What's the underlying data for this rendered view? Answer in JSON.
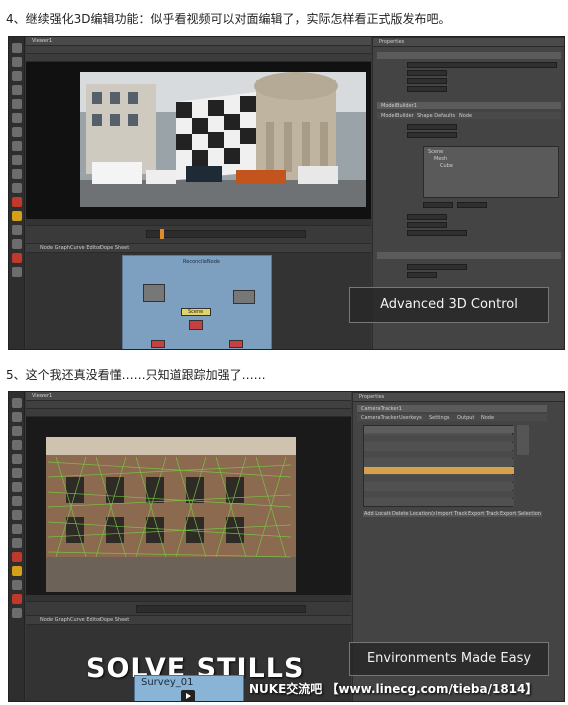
{
  "captions": {
    "first": "4、继续强化3D编辑功能：似乎看视频可以对面编辑了，实际怎样看正式版发布吧。",
    "second": "5、这个我还真没看懂……只知道跟踪加强了……"
  },
  "shot1": {
    "viewer_tab": "Viewer1",
    "properties_tab": "Properties",
    "node_graph_tabs": [
      "Node Graph",
      "Curve Editor",
      "Dope Sheet"
    ],
    "overlay_label": "Advanced 3D Control",
    "node_labels": [
      "ReconcileNode",
      "Scene",
      "Camera",
      "Read1"
    ],
    "properties_title": "ModelBuilder1",
    "properties_tabs": [
      "ModelBuilder",
      "Shape Defaults",
      "Node"
    ],
    "scene_items": [
      "Scene",
      "Mesh",
      "Cube"
    ],
    "colors": {
      "accent": "#e08a2c",
      "toolbar": "#2e2e2e",
      "panel": "#444444"
    }
  },
  "shot2": {
    "viewer_tab": "Viewer1",
    "properties_tab": "Properties",
    "properties_title": "CameraTracker1",
    "properties_tabs": [
      "CameraTracker",
      "Userkeys",
      "Settings",
      "Output",
      "Node"
    ],
    "node_graph_tabs": [
      "Node Graph",
      "Curve Editor",
      "Dope Sheet"
    ],
    "headline": "SOLVE STILLS",
    "overlay_label": "Environments Made Easy",
    "watermark": "NUKE交流吧 【www.linecg.com/tieba/1814】",
    "thumbnail_title": "Survey_01",
    "table_buttons": [
      "Add Location",
      "Delete Location(s)",
      "Import Tracks",
      "Export Tracks",
      "Export Selection"
    ],
    "colors": {
      "track_green": "#7ac943",
      "highlight_row": "#d9a04a",
      "headline": "#ffffff"
    }
  }
}
